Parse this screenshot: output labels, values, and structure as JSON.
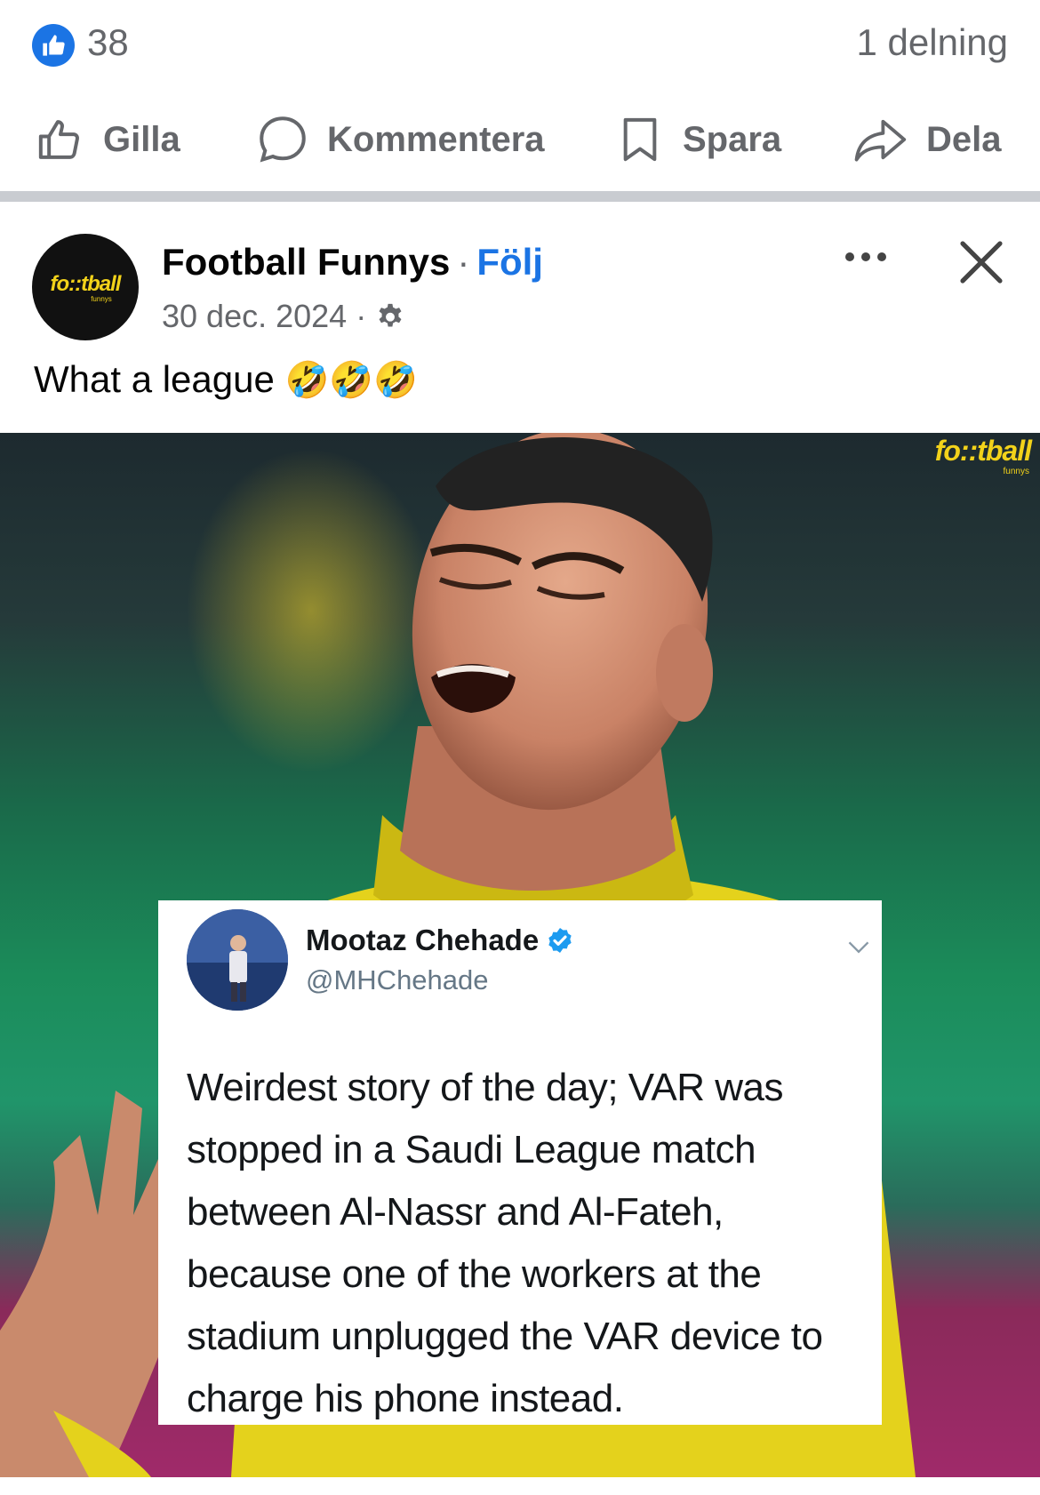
{
  "reactions": {
    "like_count": "38",
    "share_count": "1 delning"
  },
  "actions": [
    {
      "label": "Gilla",
      "icon": "thumbs-up-icon"
    },
    {
      "label": "Kommentera",
      "icon": "comment-icon"
    },
    {
      "label": "Spara",
      "icon": "bookmark-icon"
    },
    {
      "label": "Dela",
      "icon": "share-icon"
    }
  ],
  "post": {
    "page_name": "Football Funnys",
    "separator": "·",
    "follow_label": "Följ",
    "date": "30 dec. 2024",
    "date_separator": "·",
    "caption_text": "What a league",
    "caption_emoji": "🤣🤣🤣",
    "avatar_logo": "fo::tball",
    "avatar_logo_sub": "funnys"
  },
  "photo": {
    "watermark": "fo::tball",
    "watermark_sub": "funnys"
  },
  "tweet": {
    "name": "Mootaz Chehade",
    "handle": "@MHChehade",
    "text": "Weirdest story of the day; VAR was stopped in a Saudi League match between Al-Nassr and Al-Fateh, because one of the workers at the stadium unplugged the VAR device to charge his phone instead."
  },
  "colors": {
    "facebook_blue": "#1b74e4",
    "secondary_text": "#65676b",
    "verified_blue": "#1d9bf0",
    "logo_yellow": "#f2d21a"
  }
}
